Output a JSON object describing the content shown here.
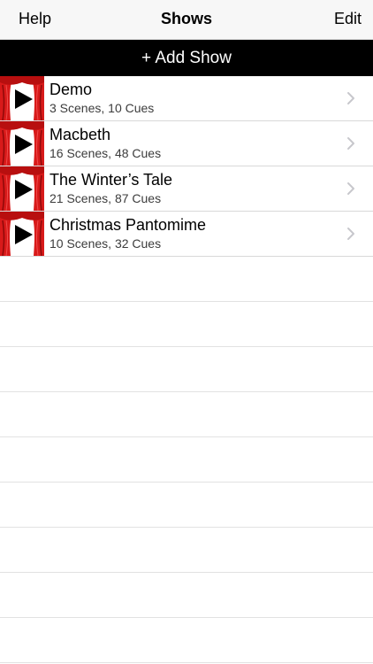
{
  "navbar": {
    "left_label": "Help",
    "title": "Shows",
    "right_label": "Edit"
  },
  "add_bar": {
    "label": "+ Add Show"
  },
  "shows": [
    {
      "title": "Demo",
      "subtitle": "3 Scenes, 10 Cues"
    },
    {
      "title": "Macbeth",
      "subtitle": "16 Scenes, 48 Cues"
    },
    {
      "title": "The Winter’s Tale",
      "subtitle": "21 Scenes, 87 Cues"
    },
    {
      "title": "Christmas Pantomime",
      "subtitle": "10 Scenes, 32 Cues"
    }
  ],
  "icons": {
    "row_thumbnail": "theater-curtain-play-icon",
    "row_chevron": "chevron-right-icon"
  },
  "colors": {
    "navbar_bg": "#f7f7f7",
    "add_bar_bg": "#000000",
    "curtain_red": "#d81a1a",
    "chevron": "#c7c7cc"
  }
}
